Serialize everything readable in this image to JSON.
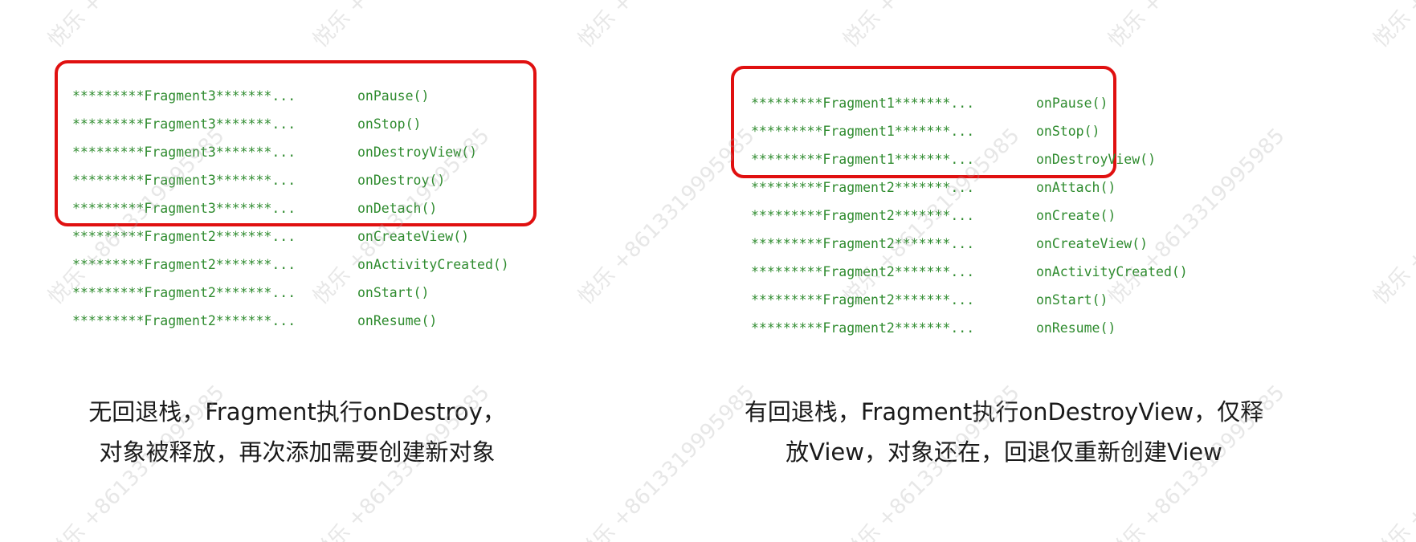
{
  "left": {
    "log_lines": [
      {
        "prefix": "*********Fragment3*******...",
        "method": "onPause()"
      },
      {
        "prefix": "*********Fragment3*******...",
        "method": "onStop()"
      },
      {
        "prefix": "*********Fragment3*******...",
        "method": "onDestroyView()"
      },
      {
        "prefix": "*********Fragment3*******...",
        "method": "onDestroy()"
      },
      {
        "prefix": "*********Fragment3*******...",
        "method": "onDetach()"
      },
      {
        "prefix": "*********Fragment2*******...",
        "method": "onCreateView()"
      },
      {
        "prefix": "*********Fragment2*******...",
        "method": "onActivityCreated()"
      },
      {
        "prefix": "*********Fragment2*******...",
        "method": "onStart()"
      },
      {
        "prefix": "*********Fragment2*******...",
        "method": "onResume()"
      }
    ],
    "caption_lines": [
      "无回退栈，Fragment执行onDestroy，",
      "对象被释放，再次添加需要创建新对象"
    ]
  },
  "right": {
    "log_lines": [
      {
        "prefix": "*********Fragment1*******...",
        "method": "onPause()"
      },
      {
        "prefix": "*********Fragment1*******...",
        "method": "onStop()"
      },
      {
        "prefix": "*********Fragment1*******...",
        "method": "onDestroyView()"
      },
      {
        "prefix": "*********Fragment2*******...",
        "method": "onAttach()"
      },
      {
        "prefix": "*********Fragment2*******...",
        "method": "onCreate()"
      },
      {
        "prefix": "*********Fragment2*******...",
        "method": "onCreateView()"
      },
      {
        "prefix": "*********Fragment2*******...",
        "method": "onActivityCreated()"
      },
      {
        "prefix": "*********Fragment2*******...",
        "method": "onStart()"
      },
      {
        "prefix": "*********Fragment2*******...",
        "method": "onResume()"
      }
    ],
    "caption_lines": [
      "有回退栈，Fragment执行onDestroyView，仅释",
      "放View，对象还在，回退仅重新创建View"
    ]
  },
  "watermark": {
    "brand": "悦乐",
    "phone": "+8613319995985"
  },
  "colors": {
    "log_text": "#2e8b2e",
    "highlight_border": "#e01010",
    "caption_text": "#1a1a1a"
  }
}
